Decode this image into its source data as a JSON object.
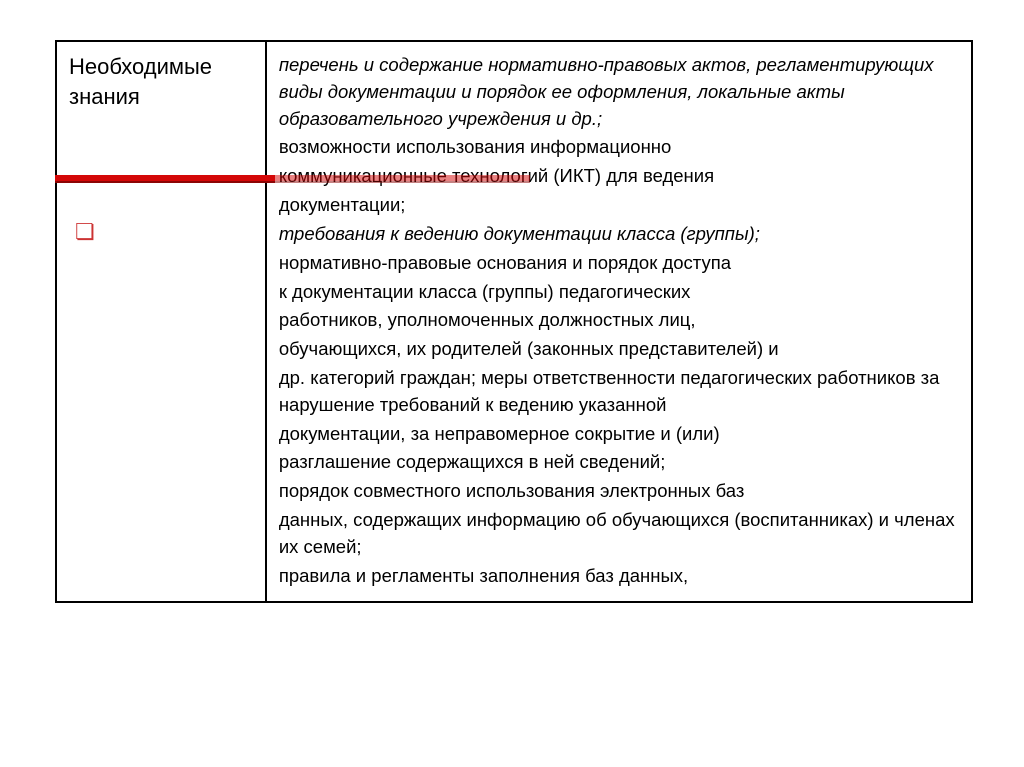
{
  "table": {
    "left": {
      "heading": "Необходимые знания",
      "bullet": "❏"
    },
    "right": {
      "p1_italic": "перечень и содержание нормативно-правовых актов, регламентирующих виды документации и порядок ее оформления, локальные акты образовательного учреждения и др.;",
      "p2_a": "возможности использования информационно",
      "p2_b": "коммуникационные технологий (ИКТ) для ведения",
      "p2_c": "документации;",
      "p3_italic": "требования к ведению документации класса (группы);",
      "p4_a": "нормативно-правовые основания и порядок доступа",
      "p4_b": "к документации класса (группы) педагогических",
      "p4_c": "работников, уполномоченных должностных лиц,",
      "p4_d": "обучающихся, их родителей (законных представителей) и",
      "p4_e": "др. категорий граждан; меры ответственности педагогических работников за нарушение требований к ведению указанной",
      "p4_f": "документации, за неправомерное сокрытие и (или)",
      "p4_g": "разглашение содержащихся в ней сведений;",
      "p5_a": "порядок совместного использования электронных баз",
      "p5_b": "данных, содержащих информацию об обучающихся (воспитанниках) и членах их семей;",
      "p6": "правила и регламенты заполнения баз данных,"
    }
  }
}
